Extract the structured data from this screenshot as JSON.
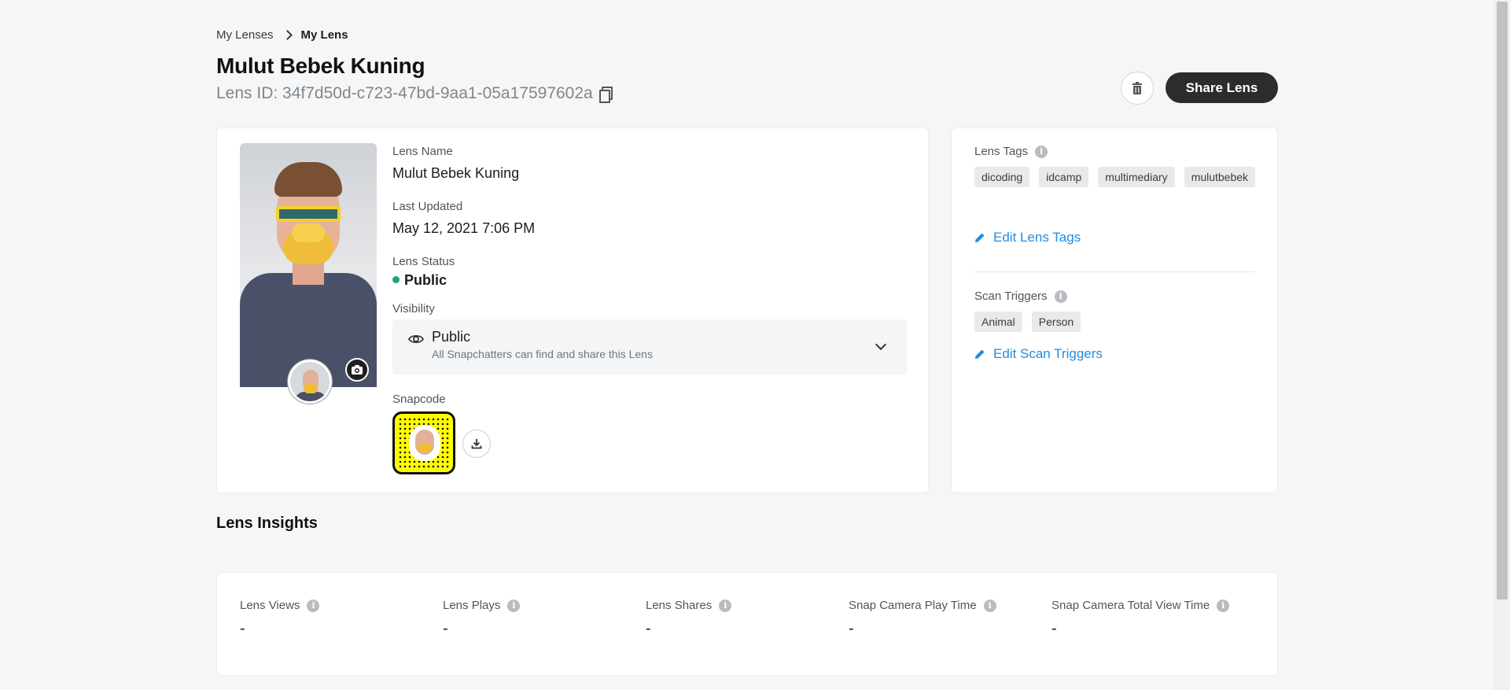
{
  "breadcrumb": {
    "root": "My Lenses",
    "current": "My Lens"
  },
  "page": {
    "title": "Mulut Bebek Kuning",
    "lens_id": "Lens ID: 34f7d50d-c723-47bd-9aa1-05a17597602a"
  },
  "actions": {
    "share_label": "Share Lens",
    "delete_icon": "trash-icon"
  },
  "details": {
    "lens_name_label": "Lens Name",
    "lens_name": "Mulut Bebek Kuning",
    "last_updated_label": "Last Updated",
    "last_updated": "May 12, 2021 7:06 PM",
    "status_label": "Lens Status",
    "status": "Public",
    "status_color": "#1aa37a",
    "visibility_label": "Visibility",
    "visibility_value": "Public",
    "visibility_desc": "All Snapchatters can find and share this Lens",
    "snapcode_label": "Snapcode"
  },
  "side": {
    "tags_label": "Lens Tags",
    "tags": [
      "dicoding",
      "idcamp",
      "multimediary",
      "mulutbebek"
    ],
    "edit_tags": "Edit Lens Tags",
    "triggers_label": "Scan Triggers",
    "triggers": [
      "Animal",
      "Person"
    ],
    "edit_triggers": "Edit Scan Triggers",
    "link_color": "#1f8ee0"
  },
  "insights": {
    "title": "Lens Insights",
    "metrics": [
      {
        "label": "Lens Views",
        "value": "-"
      },
      {
        "label": "Lens Plays",
        "value": "-"
      },
      {
        "label": "Lens Shares",
        "value": "-"
      },
      {
        "label": "Snap Camera Play Time",
        "value": "-"
      },
      {
        "label": "Snap Camera Total View Time",
        "value": "-"
      }
    ]
  }
}
